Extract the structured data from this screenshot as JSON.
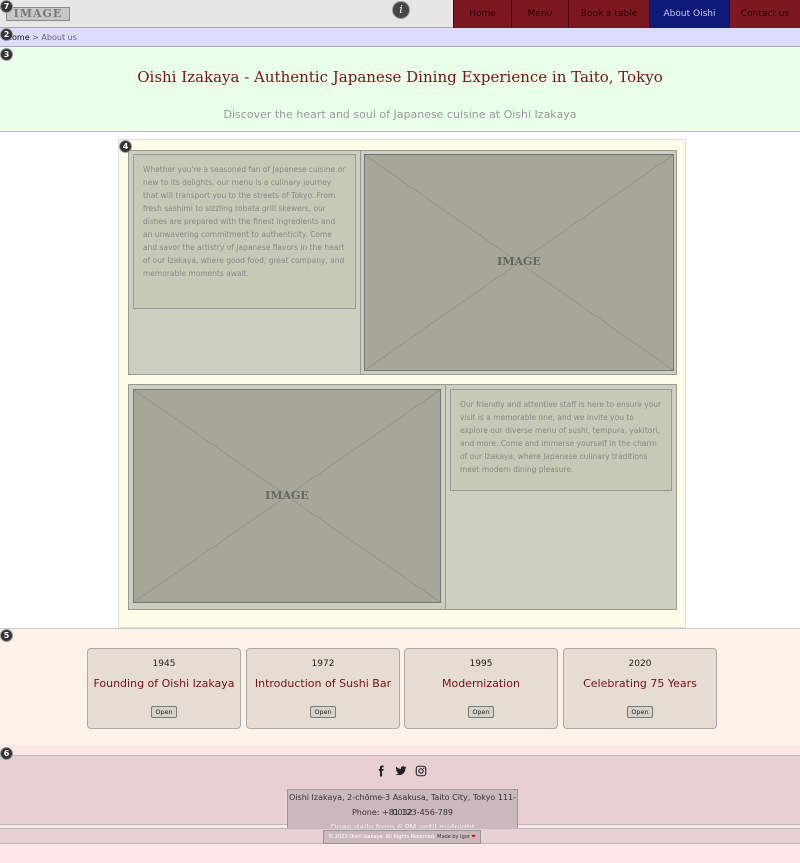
{
  "header": {
    "logo_text": "IMAGE",
    "info_icon": "info-icon",
    "nav": [
      {
        "label": "Home",
        "active": false
      },
      {
        "label": "Menu",
        "active": false
      },
      {
        "label": "Book a table",
        "active": false
      },
      {
        "label": "About Oishi",
        "active": true
      },
      {
        "label": "Contact us",
        "active": false
      }
    ]
  },
  "badges": [
    "7",
    "2",
    "3",
    "4",
    "5",
    "6"
  ],
  "breadcrumb": {
    "home": "Home",
    "separator": ">",
    "current": "About us"
  },
  "hero": {
    "title": "Oishi Izakaya - Authentic Japanese Dining Experience in Taito, Tokyo",
    "subtitle": "Discover the heart and soul of Japanese cuisine at Oishi Izakaya"
  },
  "about": {
    "paragraph1": "Whether you're a seasoned fan of Japanese cuisine or new to its delights, our menu is a culinary journey that will transport you to the streets of Tokyo. From fresh sashimi to sizzling robata grill skewers, our dishes are prepared with the finest ingredients and an unwavering commitment to authenticity. Come and savor the artistry of Japanese flavors in the heart of our Izakaya, where good food, great company, and memorable moments await.",
    "paragraph2": "Our friendly and attentive staff is here to ensure your visit is a memorable one, and we invite you to explore our diverse menu of sushi, tempura, yakitori, and more. Come and immerse yourself in the charm of our Izakaya, where Japanese culinary traditions meet modern dining pleasure.",
    "image_label": "IMAGE"
  },
  "timeline": [
    {
      "year": "1945",
      "title": "Founding of Oishi Izakaya",
      "button": "Open"
    },
    {
      "year": "1972",
      "title": "Introduction of Sushi Bar",
      "button": "Open"
    },
    {
      "year": "1995",
      "title": "Modernization",
      "button": "Open"
    },
    {
      "year": "2020",
      "title": "Celebrating 75 Years",
      "button": "Open"
    }
  ],
  "footer": {
    "social": [
      "facebook-icon",
      "twitter-icon",
      "instagram-icon"
    ],
    "address": "Oishi Izakaya, 2-chōme-3 Asakusa, Taito City, Tokyo 111-0032",
    "phone": "Phone: +81 123-456-789",
    "hours": "Open daily from 6 PM until midnight",
    "copyright": "© 2023 Oishi Izakaya. All Rights Reserved.",
    "made_by": "Made by Igor",
    "heart": "❤"
  },
  "colors": {
    "nav_bg": "#7d1720",
    "nav_active_bg": "#0d1a7a",
    "accent_text": "#7a1018"
  }
}
